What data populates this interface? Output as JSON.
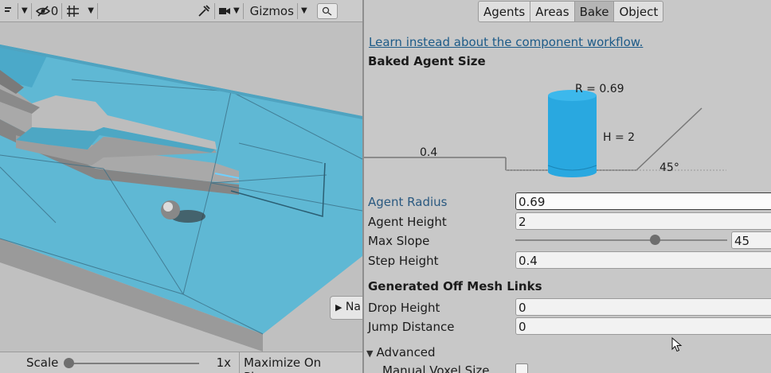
{
  "scene": {
    "toolbar": {
      "hidden_objects_count": "0",
      "gizmos_label": "Gizmos",
      "search_icon": "search-icon"
    },
    "overlay_button_label": "Na",
    "footer": {
      "scale_label": "Scale",
      "scale_value": "1x",
      "scale_fraction": 0.0,
      "maximize_label": "Maximize On Play"
    }
  },
  "navigation": {
    "tabs": [
      "Agents",
      "Areas",
      "Bake",
      "Object"
    ],
    "active_tab": "Bake",
    "component_link": "Learn instead about the component workflow.",
    "baked_agent_size": {
      "title": "Baked Agent Size",
      "radius_text": "R = 0.69",
      "height_text": "H = 2",
      "step_text": "0.4",
      "slope_text": "45°",
      "colors": {
        "agent": "#29a8e0",
        "agent_top": "#3cb8ec"
      }
    },
    "fields": {
      "agent_radius": {
        "label": "Agent Radius",
        "value": "0.69"
      },
      "agent_height": {
        "label": "Agent Height",
        "value": "2"
      },
      "max_slope": {
        "label": "Max Slope",
        "value": "45",
        "fraction": 0.6667
      },
      "step_height": {
        "label": "Step Height",
        "value": "0.4"
      }
    },
    "off_mesh": {
      "title": "Generated Off Mesh Links",
      "drop_height": {
        "label": "Drop Height",
        "value": "0"
      },
      "jump_distance": {
        "label": "Jump Distance",
        "value": "0"
      }
    },
    "advanced": {
      "label": "Advanced",
      "manual_voxel_size": {
        "label": "Manual Voxel Size",
        "checked": false
      }
    }
  }
}
